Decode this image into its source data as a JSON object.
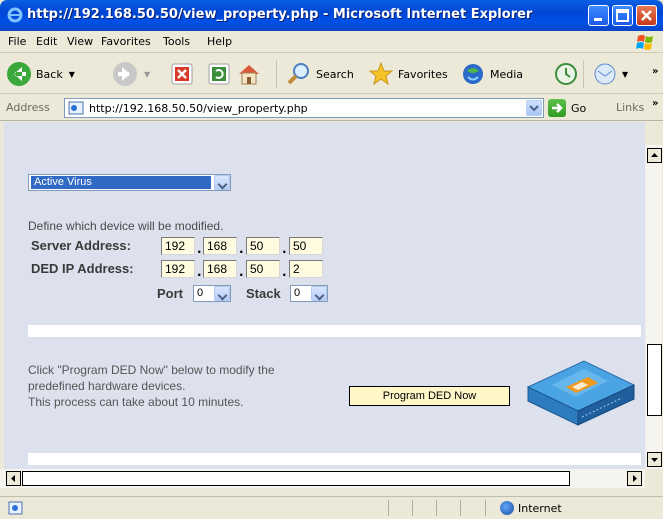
{
  "window": {
    "title": "http://192.168.50.50/view_property.php - Microsoft Internet Explorer"
  },
  "menu": {
    "items": [
      "File",
      "Edit",
      "View",
      "Favorites",
      "Tools",
      "Help"
    ]
  },
  "toolbar": {
    "back_label": "Back",
    "search_label": "Search",
    "favorites_label": "Favorites",
    "media_label": "Media"
  },
  "address": {
    "label": "Address",
    "url": "http://192.168.50.50/view_property.php",
    "go_label": "Go",
    "links_label": "Links"
  },
  "page": {
    "virus_select": "Active Virus",
    "define_text": "Define which device will be modified.",
    "server_label": "Server Address:",
    "server_ip": [
      "192",
      "168",
      "50",
      "50"
    ],
    "ded_label": "DED IP Address:",
    "ded_ip": [
      "192",
      "168",
      "50",
      "2"
    ],
    "port_label": "Port",
    "port_value": "0",
    "stack_label": "Stack",
    "stack_value": "0",
    "program_text_1": "Click \"Program DED Now\" below to modify the",
    "program_text_2": "predefined hardware devices.",
    "program_text_3": "This process can take about 10 minutes.",
    "program_button": "Program DED Now"
  },
  "status": {
    "zone": "Internet"
  },
  "colors": {
    "titlebar": "#0050e6",
    "content_bg": "#dde1ed",
    "input_bg": "#fffbe0",
    "button_bg": "#fff7c8"
  }
}
